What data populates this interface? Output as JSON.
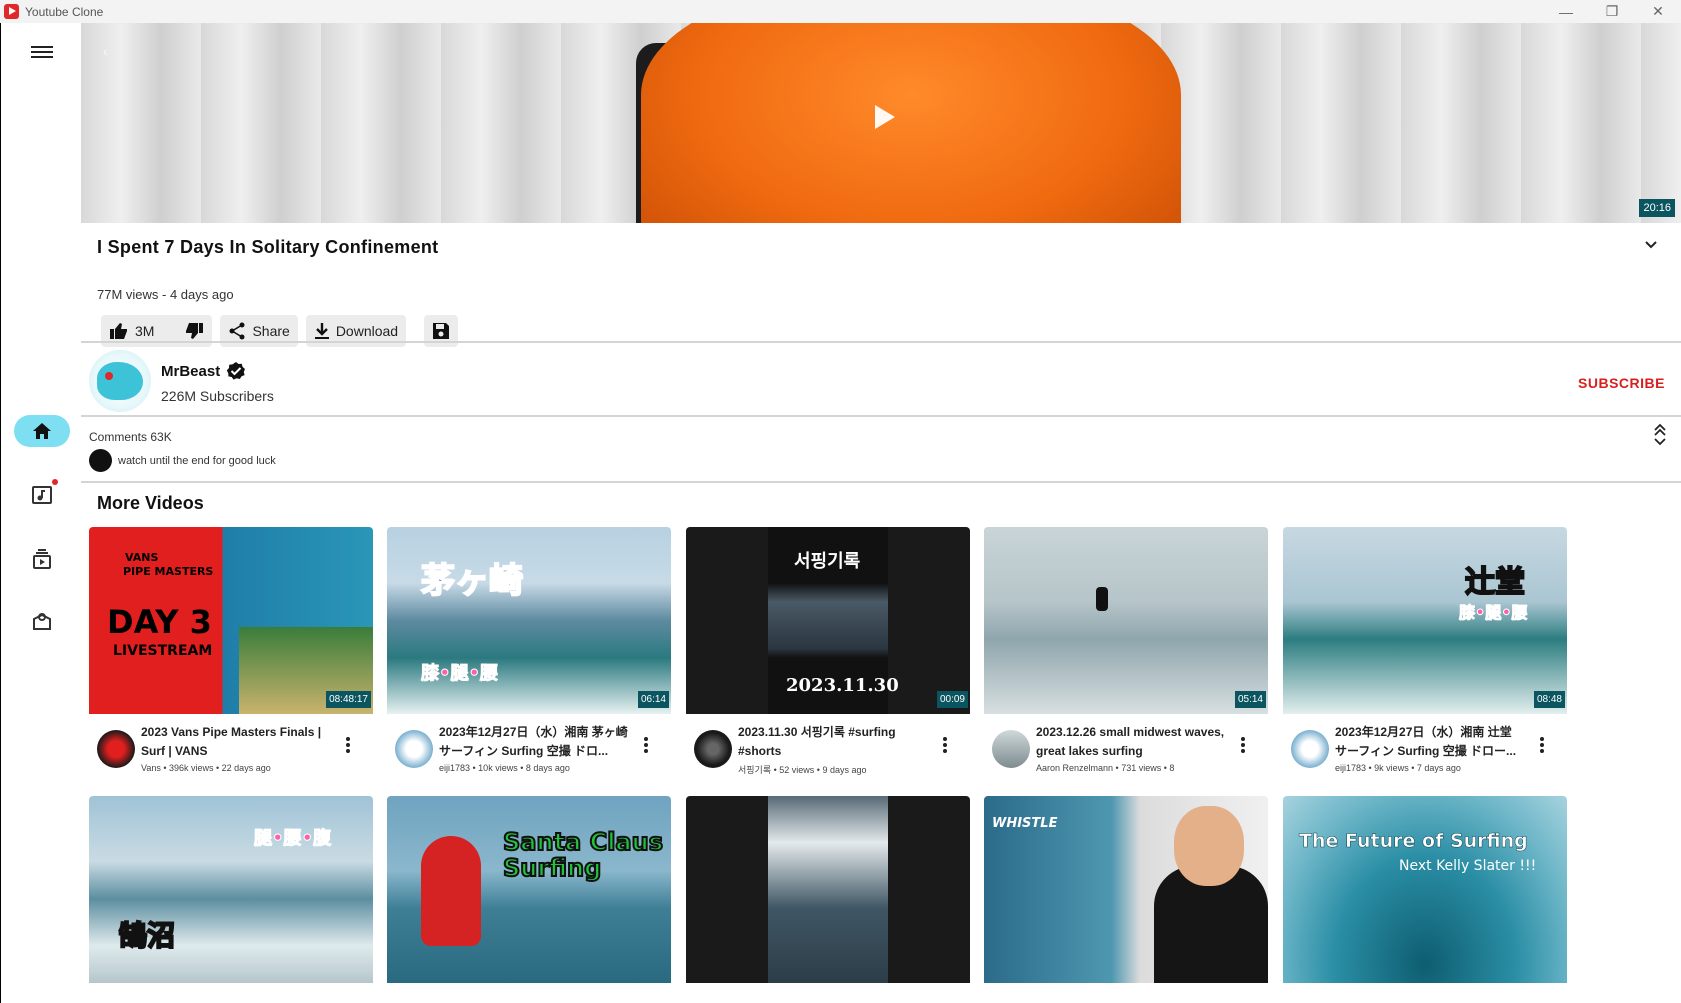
{
  "window": {
    "title": "Youtube Clone"
  },
  "hero": {
    "duration": "20:16"
  },
  "video": {
    "title": "I Spent 7 Days In Solitary Confinement",
    "meta": "77M views - 4 days ago",
    "likes": "3M",
    "share_label": "Share",
    "download_label": "Download"
  },
  "channel": {
    "name": "MrBeast",
    "subscribers": "226M Subscribers",
    "subscribe_label": "SUBSCRIBE"
  },
  "comments": {
    "header": "Comments 63K",
    "top_comment": "watch until the end for good luck"
  },
  "more_videos": {
    "heading": "More Videos",
    "items": [
      {
        "title": "2023 Vans Pipe Masters Finals | Surf | VANS",
        "sub": "Vans  •  396k views  •  22 days ago",
        "duration": "08:48:17",
        "thumb_text_1": "VANS",
        "thumb_text_2": "PIPE MASTERS",
        "thumb_text_3": "DAY 3",
        "thumb_text_4": "LIVESTREAM"
      },
      {
        "title": "2023年12月27日（水）湘南 茅ヶ崎 サーフィン Surfing 空撮 ドロ...",
        "sub": "eiji1783  •  10k views  •  8 days ago",
        "duration": "06:14",
        "thumb_text_1": "茅ヶ崎",
        "thumb_text_2": "膝•腿•腰"
      },
      {
        "title": "2023.11.30 서핑기록 #surfing #shorts",
        "sub": "서핑기록  •  52 views  •  9 days ago",
        "duration": "00:09",
        "thumb_text_1": "서핑기록",
        "thumb_text_2": "2023.11.30"
      },
      {
        "title": "2023.12.26 small midwest waves, great lakes surfing",
        "sub": "Aaron Renzelmann  •  731 views  •  8",
        "duration": "05:14"
      },
      {
        "title": "2023年12月27日（水）湘南 辻堂 サーフィン Surfing 空撮 ドロー...",
        "sub": "eiji1783  •  9k views  •  7 days ago",
        "duration": "08:48",
        "thumb_text_1": "辻堂",
        "thumb_text_2": "膝•腿•腰"
      }
    ],
    "row2": [
      {
        "thumb_text_1": "腿•腰•腹",
        "thumb_text_2": "鵠沼"
      },
      {
        "thumb_text_1": "Santa Claus",
        "thumb_text_2": "Surfing"
      },
      {},
      {
        "thumb_text_1": "WHISTLE"
      },
      {
        "thumb_text_1": "The Future of Surfing",
        "thumb_text_2": "Next Kelly Slater !!!"
      }
    ]
  },
  "colors": {
    "accent": "#7fdff2",
    "subscribe": "#d81f1f",
    "duration_bg": "#0b5560"
  }
}
